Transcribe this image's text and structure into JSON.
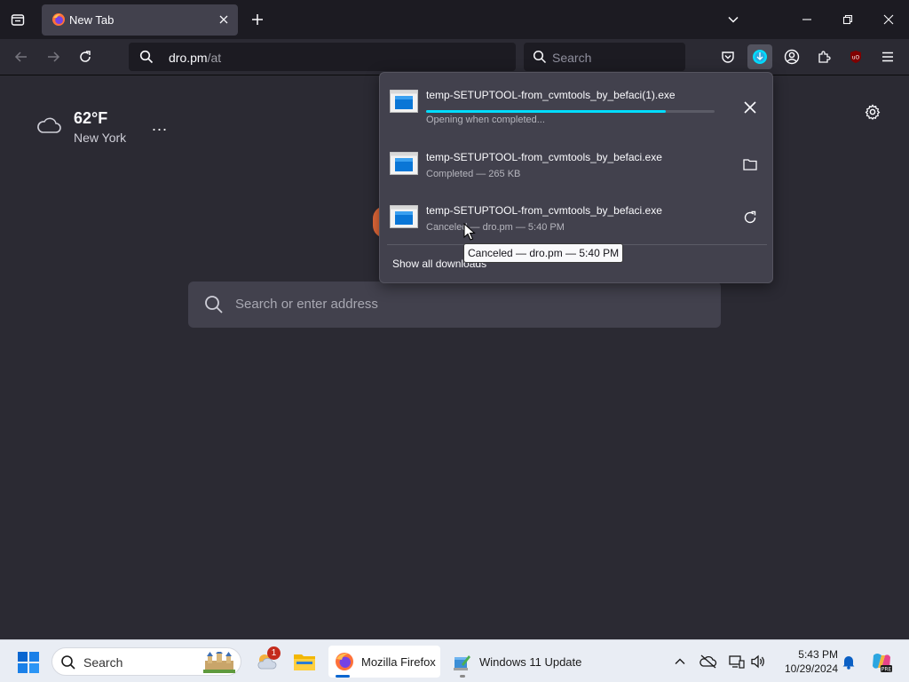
{
  "browser": {
    "tab": {
      "title": "New Tab",
      "favicon": "firefox-icon"
    },
    "url": {
      "host": "dro.pm",
      "path": "/at"
    },
    "search_placeholder": "Search",
    "accent_color": "#00ddff"
  },
  "newtab": {
    "weather": {
      "temperature": "62°F",
      "city": "New York",
      "more": "..."
    },
    "search_placeholder": "Search or enter address"
  },
  "downloads": {
    "items": [
      {
        "filename": "temp-SETUPTOOL-from_cvmtools_by_befaci(1).exe",
        "status": "Opening when completed...",
        "progress": 0.83,
        "action": "cancel"
      },
      {
        "filename": "temp-SETUPTOOL-from_cvmtools_by_befaci.exe",
        "status": "Completed — 265 KB",
        "action": "show-in-folder"
      },
      {
        "filename": "temp-SETUPTOOL-from_cvmtools_by_befaci.exe",
        "status": "Canceled — dro.pm — 5:40 PM",
        "action": "retry"
      }
    ],
    "show_all": "Show all downloads",
    "tooltip": "Canceled — dro.pm — 5:40 PM"
  },
  "taskbar": {
    "search_placeholder": "Search",
    "widgets_badge": "1",
    "apps": [
      {
        "label": "Mozilla Firefox"
      },
      {
        "label": "Windows 11 Update"
      }
    ],
    "clock": {
      "time": "5:43 PM",
      "date": "10/29/2024"
    }
  }
}
